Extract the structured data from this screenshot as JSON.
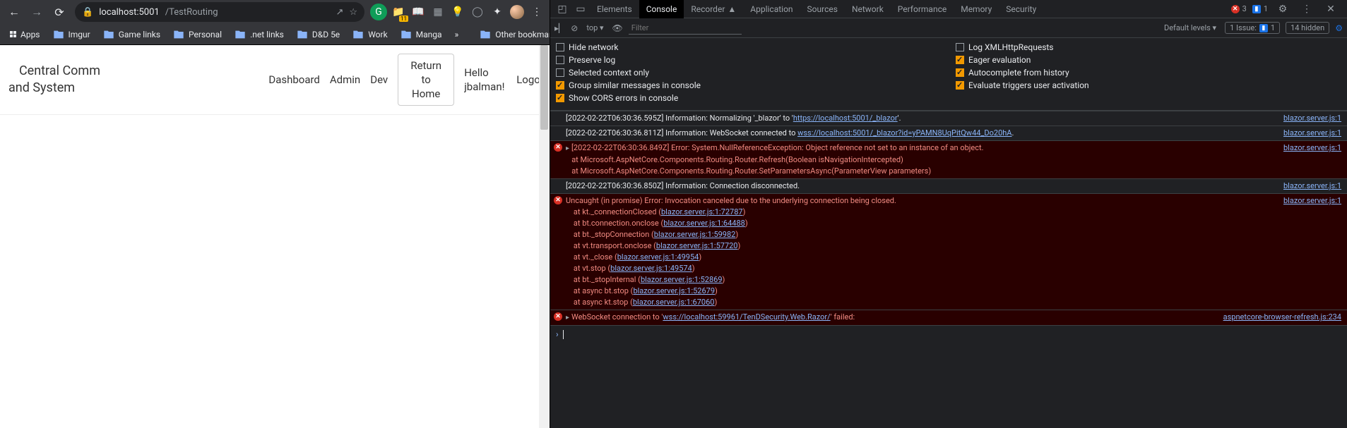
{
  "browser": {
    "url_host": "localhost:5001",
    "url_path": "/TestRouting",
    "bookmarks": [
      "Apps",
      "Imgur",
      "Game links",
      "Personal",
      ".net links",
      "D&D 5e",
      "Work",
      "Manga"
    ],
    "overflow_label": "»",
    "other_bookmarks": "Other bookmarks",
    "reading_list": "Reading list",
    "ext_badge": "11"
  },
  "page": {
    "brand_line1": "Central Comm",
    "brand_line2": "and System",
    "nav": {
      "dashboard": "Dashboard",
      "admin": "Admin",
      "dev": "Dev",
      "return": "Return to Home",
      "hello": "Hello jbalman!",
      "logout": "Logout"
    }
  },
  "devtools": {
    "tabs": [
      "Elements",
      "Console",
      "Recorder",
      "Application",
      "Sources",
      "Network",
      "Performance",
      "Memory",
      "Security"
    ],
    "active_tab": "Console",
    "errors_count": "3",
    "issues_label": "1 Issue:",
    "issues_count": "1",
    "hidden_label": "14 hidden",
    "secondbar": {
      "context": "top ▾",
      "filter_placeholder": "Filter",
      "levels": "Default levels ▾"
    },
    "settings_left": [
      {
        "label": "Hide network",
        "on": false
      },
      {
        "label": "Preserve log",
        "on": false
      },
      {
        "label": "Selected context only",
        "on": false
      },
      {
        "label": "Group similar messages in console",
        "on": true
      },
      {
        "label": "Show CORS errors in console",
        "on": true
      }
    ],
    "settings_right": [
      {
        "label": "Log XMLHttpRequests",
        "on": false
      },
      {
        "label": "Eager evaluation",
        "on": true
      },
      {
        "label": "Autocomplete from history",
        "on": true
      },
      {
        "label": "Evaluate triggers user activation",
        "on": true
      }
    ],
    "logs": [
      {
        "type": "info",
        "msg": "[2022-02-22T06:30:36.595Z] Information: Normalizing '_blazor' to '",
        "link_inline": "https://localhost:5001/_blazor",
        "msg_after": "'.",
        "src": "blazor.server.js:1"
      },
      {
        "type": "info",
        "msg": "[2022-02-22T06:30:36.811Z] Information: WebSocket connected to ",
        "link_inline": "wss://localhost:5001/_blazor?id=yPAMN8UqPitQw44_Do20hA",
        "msg_after": ".",
        "src": "blazor.server.js:1"
      },
      {
        "type": "error",
        "expandable": true,
        "msg": "[2022-02-22T06:30:36.849Z] Error: System.NullReferenceException: Object reference not set to an instance of an object.\n   at Microsoft.AspNetCore.Components.Routing.Router.Refresh(Boolean isNavigationIntercepted)\n   at Microsoft.AspNetCore.Components.Routing.Router.SetParametersAsync(ParameterView parameters)",
        "src": "blazor.server.js:1"
      },
      {
        "type": "info",
        "msg": "[2022-02-22T06:30:36.850Z] Information: Connection disconnected.",
        "src": "blazor.server.js:1"
      },
      {
        "type": "error",
        "msg": "Uncaught (in promise) Error: Invocation canceled due to the underlying connection being closed.",
        "stack": [
          {
            "t": "    at kt._connectionClosed (",
            "l": "blazor.server.js:1:72787",
            "a": ")"
          },
          {
            "t": "    at bt.connection.onclose (",
            "l": "blazor.server.js:1:64488",
            "a": ")"
          },
          {
            "t": "    at bt._stopConnection (",
            "l": "blazor.server.js:1:59982",
            "a": ")"
          },
          {
            "t": "    at vt.transport.onclose (",
            "l": "blazor.server.js:1:57720",
            "a": ")"
          },
          {
            "t": "    at vt._close (",
            "l": "blazor.server.js:1:49954",
            "a": ")"
          },
          {
            "t": "    at vt.stop (",
            "l": "blazor.server.js:1:49574",
            "a": ")"
          },
          {
            "t": "    at bt._stopInternal (",
            "l": "blazor.server.js:1:52869",
            "a": ")"
          },
          {
            "t": "    at async bt.stop (",
            "l": "blazor.server.js:1:52679",
            "a": ")"
          },
          {
            "t": "    at async kt.stop (",
            "l": "blazor.server.js:1:67060",
            "a": ")"
          }
        ],
        "src": "blazor.server.js:1"
      },
      {
        "type": "error",
        "expandable": true,
        "msg": "WebSocket connection to '",
        "link_inline": "wss://localhost:59961/TenDSecurity.Web.Razor/",
        "msg_after": "' failed:",
        "src": "aspnetcore-browser-refresh.js:234"
      }
    ]
  }
}
